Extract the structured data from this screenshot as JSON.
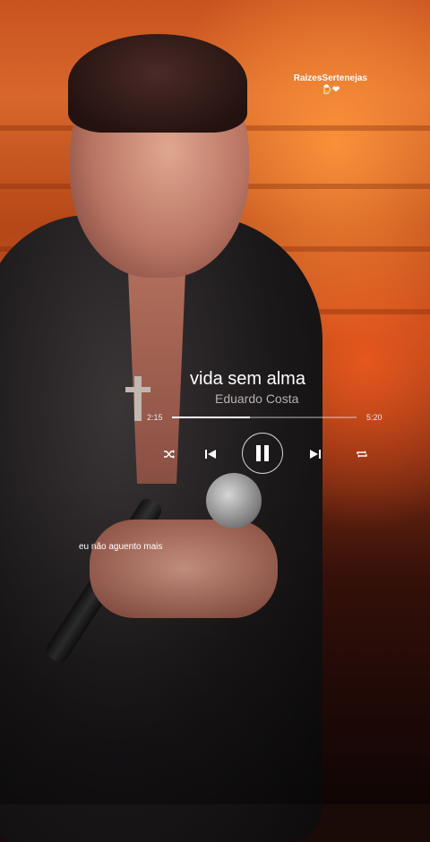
{
  "watermark": {
    "name": "RaizesSertenejas",
    "emoji": "🍺❤"
  },
  "player": {
    "song_title": "vida sem alma",
    "artist": "Eduardo Costa",
    "current_time": "2:15",
    "total_time": "5:20",
    "progress": 0.42
  },
  "lyric": "eu não aguento mais",
  "colors": {
    "text": "#ffffff",
    "artist_text": "#b6b0ae",
    "track": "#ffffff"
  },
  "icons": {
    "shuffle": "shuffle-icon",
    "previous": "skip-previous-icon",
    "play_pause": "pause-icon",
    "next": "skip-next-icon",
    "repeat": "repeat-icon"
  }
}
